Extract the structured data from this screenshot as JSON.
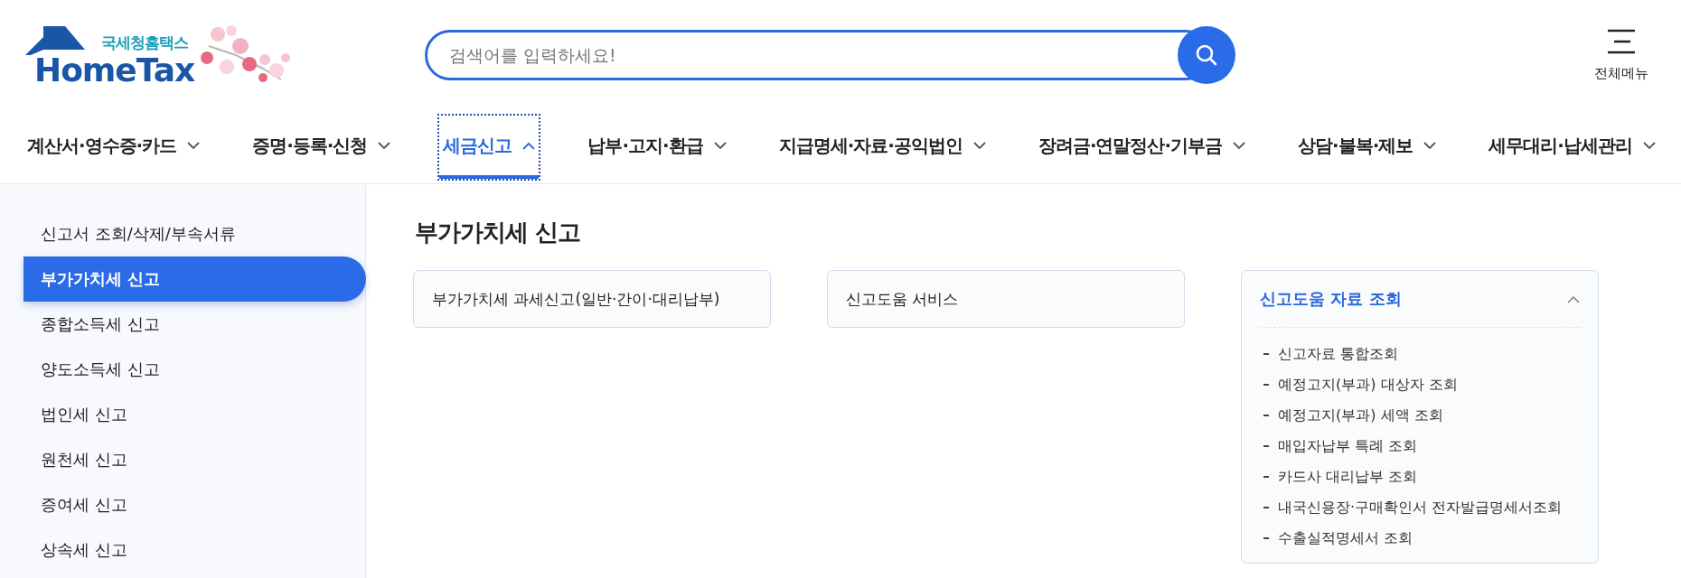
{
  "header": {
    "logo": {
      "subtitle": "국세청홈택스",
      "title": "HomeTax"
    },
    "search": {
      "placeholder": "검색어를 입력하세요!"
    },
    "menu_button": {
      "label": "전체메뉴"
    }
  },
  "nav": [
    {
      "label": "계산서·영수증·카드",
      "selected": false,
      "expanded": false
    },
    {
      "label": "증명·등록·신청",
      "selected": false,
      "expanded": false
    },
    {
      "label": "세금신고",
      "selected": true,
      "expanded": true
    },
    {
      "label": "납부·고지·환급",
      "selected": false,
      "expanded": false
    },
    {
      "label": "지급명세·자료·공익법인",
      "selected": false,
      "expanded": false
    },
    {
      "label": "장려금·연말정산·기부금",
      "selected": false,
      "expanded": false
    },
    {
      "label": "상담·불복·제보",
      "selected": false,
      "expanded": false
    },
    {
      "label": "세무대리·납세관리",
      "selected": false,
      "expanded": false
    }
  ],
  "sidebar": {
    "items": [
      {
        "label": "신고서 조회/삭제/부속서류",
        "selected": false
      },
      {
        "label": "부가가치세 신고",
        "selected": true
      },
      {
        "label": "종합소득세 신고",
        "selected": false
      },
      {
        "label": "양도소득세 신고",
        "selected": false
      },
      {
        "label": "법인세 신고",
        "selected": false
      },
      {
        "label": "원천세 신고",
        "selected": false
      },
      {
        "label": "증여세 신고",
        "selected": false
      },
      {
        "label": "상속세 신고",
        "selected": false
      }
    ]
  },
  "content": {
    "title": "부가가치세 신고",
    "cards": [
      {
        "title": "부가가치세 과세신고(일반·간이·대리납부)",
        "expanded": false
      },
      {
        "title": "신고도움 서비스",
        "expanded": false
      },
      {
        "title": "신고도움 자료 조회",
        "expanded": true,
        "items": [
          "신고자료 통합조회",
          "예정고지(부과) 대상자 조회",
          "예정고지(부과) 세액 조회",
          "매입자납부 특례 조회",
          "카드사 대리납부 조회",
          "내국신용장·구매확인서 전자발급명세서조회",
          "수출실적명세서 조회"
        ]
      }
    ]
  }
}
